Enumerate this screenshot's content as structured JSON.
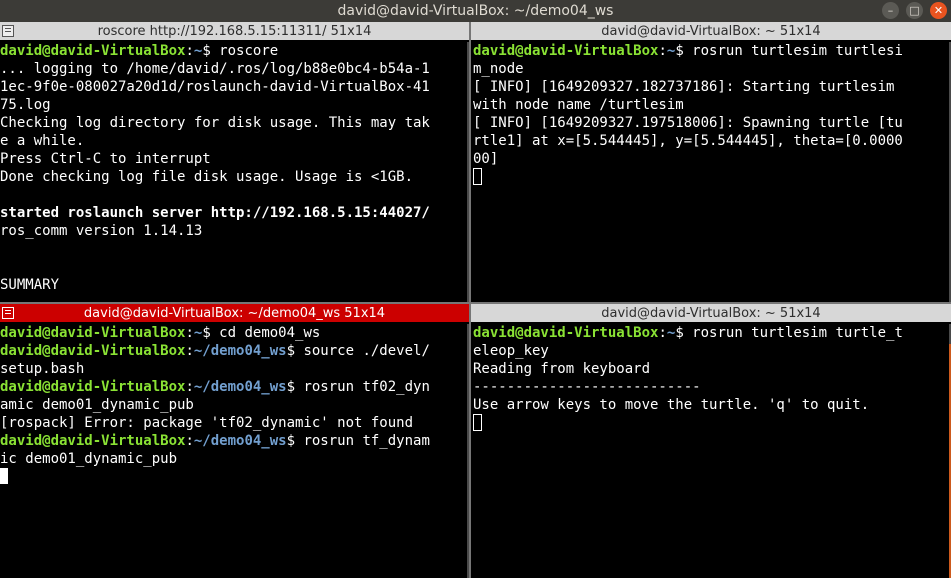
{
  "window": {
    "title": "david@david-VirtualBox: ~/demo04_ws",
    "minimize_glyph": "–",
    "maximize_glyph": "□",
    "close_glyph": "✕"
  },
  "panes": {
    "top_left": {
      "title": "roscore http://192.168.5.15:11311/ 51x14",
      "active": false,
      "lines": [
        [
          {
            "t": "david@david-VirtualBox",
            "c": "u"
          },
          {
            "t": ":",
            "c": ""
          },
          {
            "t": "~",
            "c": "p"
          },
          {
            "t": "$ roscore",
            "c": ""
          }
        ],
        [
          {
            "t": "... logging to /home/david/.ros/log/b88e0bc4-b54a-1",
            "c": ""
          }
        ],
        [
          {
            "t": "1ec-9f0e-080027a20d1d/roslaunch-david-VirtualBox-41",
            "c": ""
          }
        ],
        [
          {
            "t": "75.log",
            "c": ""
          }
        ],
        [
          {
            "t": "Checking log directory for disk usage. This may tak",
            "c": ""
          }
        ],
        [
          {
            "t": "e a while.",
            "c": ""
          }
        ],
        [
          {
            "t": "Press Ctrl-C to interrupt",
            "c": ""
          }
        ],
        [
          {
            "t": "Done checking log file disk usage. Usage is <1GB.",
            "c": ""
          }
        ],
        [
          {
            "t": "",
            "c": ""
          }
        ],
        [
          {
            "t": "started roslaunch server http://192.168.5.15:44027/",
            "c": "b"
          }
        ],
        [
          {
            "t": "ros_comm version 1.14.13",
            "c": ""
          }
        ],
        [
          {
            "t": "",
            "c": ""
          }
        ],
        [
          {
            "t": "",
            "c": ""
          }
        ],
        [
          {
            "t": "SUMMARY",
            "c": ""
          }
        ]
      ],
      "cursor": null
    },
    "top_right": {
      "title": "david@david-VirtualBox: ~ 51x14",
      "active": false,
      "lines": [
        [
          {
            "t": "david@david-VirtualBox",
            "c": "u"
          },
          {
            "t": ":",
            "c": ""
          },
          {
            "t": "~",
            "c": "p"
          },
          {
            "t": "$ rosrun turtlesim turtlesi",
            "c": ""
          }
        ],
        [
          {
            "t": "m_node",
            "c": ""
          }
        ],
        [
          {
            "t": "[ INFO] [1649209327.182737186]: Starting turtlesim",
            "c": ""
          }
        ],
        [
          {
            "t": "with node name /turtlesim",
            "c": ""
          }
        ],
        [
          {
            "t": "[ INFO] [1649209327.197518006]: Spawning turtle [tu",
            "c": ""
          }
        ],
        [
          {
            "t": "rtle1] at x=[5.544445], y=[5.544445], theta=[0.0000",
            "c": ""
          }
        ],
        [
          {
            "t": "00]",
            "c": ""
          }
        ]
      ],
      "cursor": "hollow"
    },
    "bottom_left": {
      "title": "david@david-VirtualBox: ~/demo04_ws 51x14",
      "active": true,
      "lines": [
        [
          {
            "t": "david@david-VirtualBox",
            "c": "u"
          },
          {
            "t": ":",
            "c": ""
          },
          {
            "t": "~",
            "c": "p"
          },
          {
            "t": "$ cd demo04_ws",
            "c": ""
          }
        ],
        [
          {
            "t": "david@david-VirtualBox",
            "c": "u"
          },
          {
            "t": ":",
            "c": ""
          },
          {
            "t": "~/demo04_ws",
            "c": "p"
          },
          {
            "t": "$ source ./devel/",
            "c": ""
          }
        ],
        [
          {
            "t": "setup.bash",
            "c": ""
          }
        ],
        [
          {
            "t": "david@david-VirtualBox",
            "c": "u"
          },
          {
            "t": ":",
            "c": ""
          },
          {
            "t": "~/demo04_ws",
            "c": "p"
          },
          {
            "t": "$ rosrun tf02_dyn",
            "c": ""
          }
        ],
        [
          {
            "t": "amic demo01_dynamic_pub",
            "c": ""
          }
        ],
        [
          {
            "t": "[rospack] Error: package 'tf02_dynamic' not found",
            "c": ""
          }
        ],
        [
          {
            "t": "david@david-VirtualBox",
            "c": "u"
          },
          {
            "t": ":",
            "c": ""
          },
          {
            "t": "~/demo04_ws",
            "c": "p"
          },
          {
            "t": "$ rosrun tf_dynam",
            "c": ""
          }
        ],
        [
          {
            "t": "ic demo01_dynamic_pub",
            "c": ""
          }
        ]
      ],
      "cursor": "block"
    },
    "bottom_right": {
      "title": "david@david-VirtualBox: ~ 51x14",
      "active": false,
      "lines": [
        [
          {
            "t": "david@david-VirtualBox",
            "c": "u"
          },
          {
            "t": ":",
            "c": ""
          },
          {
            "t": "~",
            "c": "p"
          },
          {
            "t": "$ rosrun turtlesim turtle_t",
            "c": ""
          }
        ],
        [
          {
            "t": "eleop_key",
            "c": ""
          }
        ],
        [
          {
            "t": "Reading from keyboard",
            "c": ""
          }
        ],
        [
          {
            "t": "---------------------------",
            "c": ""
          }
        ],
        [
          {
            "t": "Use arrow keys to move the turtle. 'q' to quit.",
            "c": ""
          }
        ]
      ],
      "cursor": "hollow"
    }
  },
  "colors": {
    "user_host": "#8ae234",
    "path": "#729fcf",
    "active_title_bg": "#cc0000",
    "inactive_title_bg": "#d7d7d7"
  }
}
